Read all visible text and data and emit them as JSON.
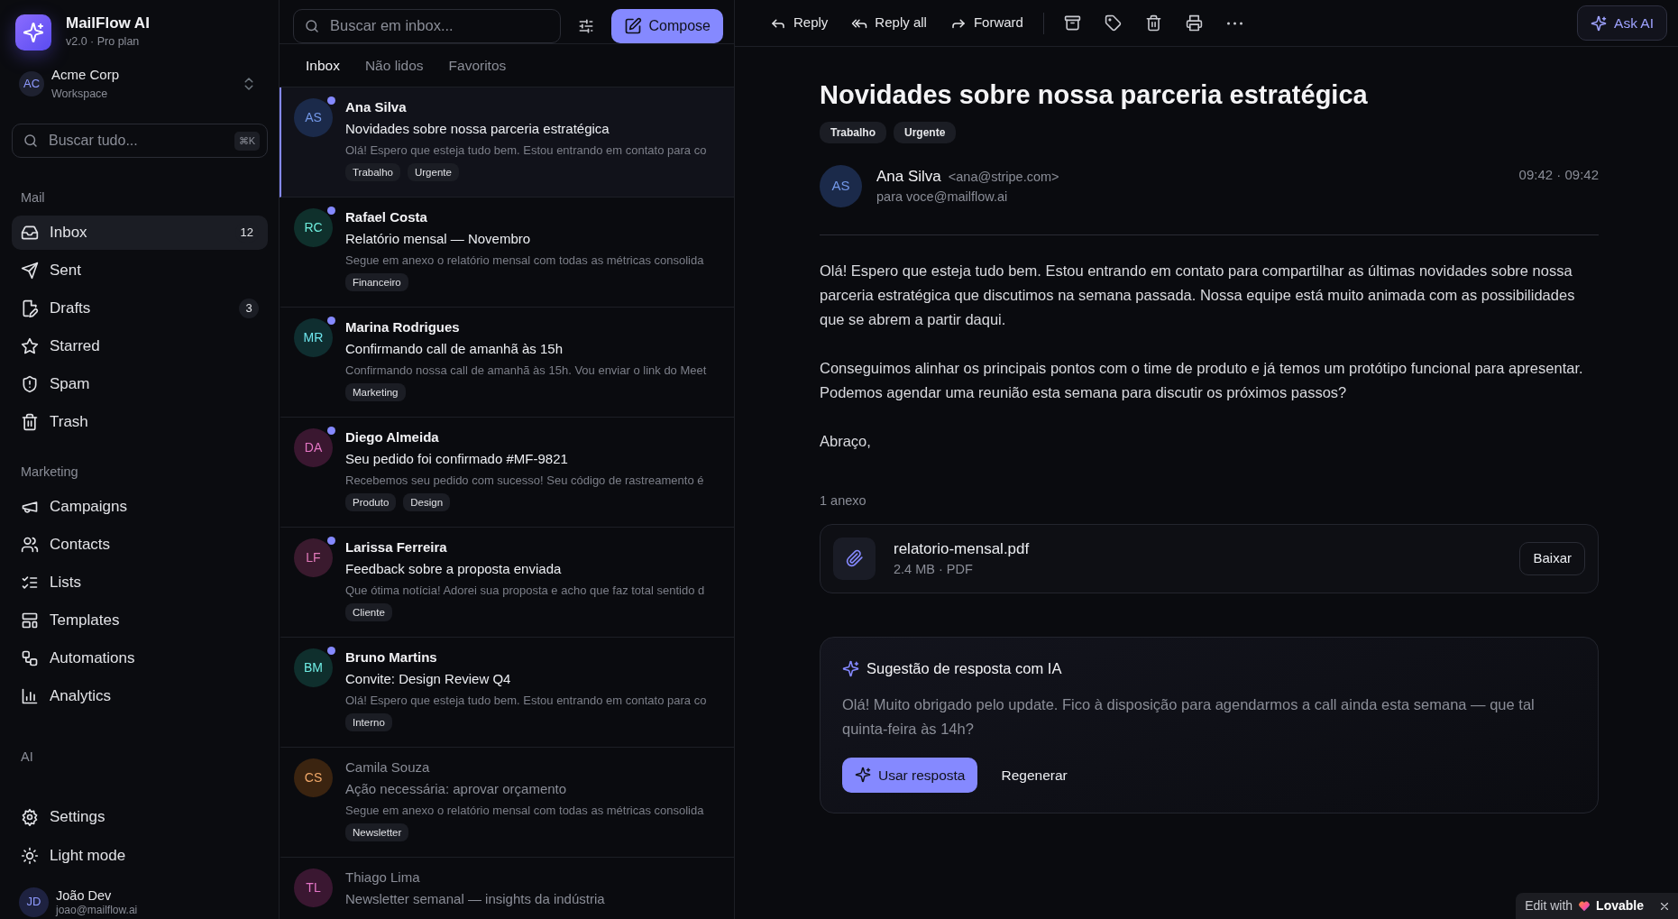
{
  "app": {
    "name": "MailFlow AI",
    "version": "v2.0 · Pro plan"
  },
  "workspace": {
    "initials": "AC",
    "name": "Acme Corp",
    "subtitle": "Workspace"
  },
  "sidebar_search": {
    "placeholder": "Buscar tudo...",
    "shortcut": "⌘K"
  },
  "sidebar": {
    "sections": [
      {
        "label": "Mail",
        "items": [
          {
            "label": "Inbox",
            "count": "12",
            "selected": true
          },
          {
            "label": "Sent",
            "selected": false
          },
          {
            "label": "Drafts",
            "count": "3",
            "selected": false
          },
          {
            "label": "Starred",
            "selected": false
          },
          {
            "label": "Spam",
            "selected": false
          },
          {
            "label": "Trash",
            "selected": false
          }
        ]
      },
      {
        "label": "Marketing",
        "items": [
          {
            "label": "Campaigns",
            "selected": false
          },
          {
            "label": "Contacts",
            "selected": false
          },
          {
            "label": "Lists",
            "selected": false
          },
          {
            "label": "Templates",
            "selected": false
          },
          {
            "label": "Automations",
            "selected": false
          },
          {
            "label": "Analytics",
            "selected": false
          }
        ]
      },
      {
        "label": "AI"
      }
    ],
    "footer_items": [
      {
        "label": "Settings",
        "selected": false
      },
      {
        "label": "Light mode",
        "selected": false
      }
    ]
  },
  "user": {
    "initials": "JD",
    "name": "João Dev",
    "email": "joao@mailflow.ai"
  },
  "list_search": {
    "placeholder": "Buscar em inbox..."
  },
  "compose_button": "Compose",
  "list_tabs": [
    {
      "label": "Inbox",
      "selected": true
    },
    {
      "label": "Não lidos",
      "selected": false
    },
    {
      "label": "Favoritos",
      "selected": false
    }
  ],
  "emails": [
    {
      "initials": "AS",
      "color": "#1b2a4a",
      "sender": "Ana Silva",
      "subject": "Novidades sobre nossa parceria estratégica",
      "preview": "Olá! Espero que esteja tudo bem. Estou entrando em contato para co",
      "tags": [
        "Trabalho",
        "Urgente"
      ],
      "unread": true,
      "selected": true
    },
    {
      "initials": "RC",
      "color": "#0f302c",
      "sender": "Rafael Costa",
      "subject": "Relatório mensal — Novembro",
      "preview": "Segue em anexo o relatório mensal com todas as métricas consolida",
      "tags": [
        "Financeiro"
      ],
      "unread": true,
      "selected": false
    },
    {
      "initials": "MR",
      "color": "#0f2e30",
      "sender": "Marina Rodrigues",
      "subject": "Confirmando call de amanhã às 15h",
      "preview": "Confirmando nossa call de amanhã às 15h. Vou enviar o link do Meet",
      "tags": [
        "Marketing"
      ],
      "unread": true,
      "selected": false
    },
    {
      "initials": "DA",
      "color": "#3a1730",
      "sender": "Diego Almeida",
      "subject": "Seu pedido foi confirmado #MF-9821",
      "preview": "Recebemos seu pedido com sucesso! Seu código de rastreamento é",
      "tags": [
        "Produto",
        "Design"
      ],
      "unread": true,
      "selected": false
    },
    {
      "initials": "LF",
      "color": "#3a1a2e",
      "sender": "Larissa Ferreira",
      "subject": "Feedback sobre a proposta enviada",
      "preview": "Que ótima notícia! Adorei sua proposta e acho que faz total sentido d",
      "tags": [
        "Cliente"
      ],
      "unread": true,
      "selected": false
    },
    {
      "initials": "BM",
      "color": "#0f2f2d",
      "sender": "Bruno Martins",
      "subject": "Convite: Design Review Q4",
      "preview": "Olá! Espero que esteja tudo bem. Estou entrando em contato para co",
      "tags": [
        "Interno"
      ],
      "unread": true,
      "selected": false
    },
    {
      "initials": "CS",
      "color": "#3b2410",
      "sender": "Camila Souza",
      "subject": "Ação necessária: aprovar orçamento",
      "preview": "Segue em anexo o relatório mensal com todas as métricas consolida",
      "tags": [
        "Newsletter"
      ],
      "unread": false,
      "selected": false
    },
    {
      "initials": "TL",
      "color": "#3a1731",
      "sender": "Thiago Lima",
      "subject": "Newsletter semanal — insights da indústria",
      "unread": false,
      "selected": false
    }
  ],
  "toolbar": {
    "actions": [
      "Reply",
      "Reply all",
      "Forward"
    ],
    "ask_ai": "Ask AI"
  },
  "message": {
    "subject": "Novidades sobre nossa parceria estratégica",
    "tags": [
      "Trabalho",
      "Urgente"
    ],
    "initials": "AS",
    "color": "#1b2a4a",
    "sender": "Ana Silva",
    "email": "<ana@stripe.com>",
    "to": "para voce@mailflow.ai",
    "time": "09:42 · 09:42",
    "body": [
      "Olá! Espero que esteja tudo bem. Estou entrando em contato para compartilhar as últimas novidades sobre nossa parceria estratégica que discutimos na semana passada. Nossa equipe está muito animada com as possibilidades que se abrem a partir daqui.",
      "Conseguimos alinhar os principais pontos com o time de produto e já temos um protótipo funcional para apresentar. Podemos agendar uma reunião esta semana para discutir os próximos passos?",
      "Abraço,"
    ]
  },
  "attachments_label": "1 anexo",
  "attachment": {
    "name": "relatorio-mensal.pdf",
    "meta": "2.4 MB · PDF",
    "button": "Baixar"
  },
  "ai_suggestion": {
    "title": "Sugestão de resposta com IA",
    "text": "Olá! Muito obrigado pelo update. Fico à disposição para agendarmos a call ainda esta semana — que tal quinta-feira às 14h?",
    "use_button": "Usar resposta",
    "regenerate_button": "Regenerar"
  },
  "badge": {
    "label": "Edit with",
    "brand": "Lovable"
  }
}
